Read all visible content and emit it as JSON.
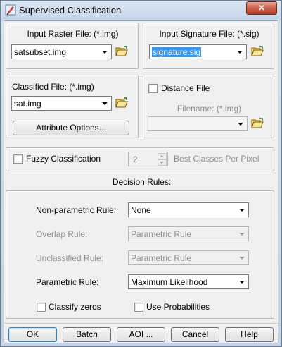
{
  "window": {
    "title": "Supervised Classification",
    "close_glyph": "✕",
    "icon": "app-pencil-icon"
  },
  "input_raster": {
    "label": "Input Raster File: (*.img)",
    "value": "satsubset.img",
    "folder_icon": "open-folder-icon"
  },
  "input_signature": {
    "label": "Input Signature File: (*.sig)",
    "value": "signature.sig",
    "folder_icon": "open-folder-icon"
  },
  "classified_file": {
    "label": "Classified File: (*.img)",
    "value": "sat.img",
    "attribute_button": "Attribute Options..."
  },
  "distance_file": {
    "checkbox_label": "Distance File",
    "filename_label": "Filename: (*.img)",
    "value": ""
  },
  "fuzzy": {
    "checkbox_label": "Fuzzy Classification",
    "best_classes_value": "2",
    "best_classes_label": "Best Classes Per Pixel"
  },
  "decision_rules": {
    "heading": "Decision Rules:",
    "non_parametric": {
      "label": "Non-parametric Rule:",
      "value": "None"
    },
    "overlap": {
      "label": "Overlap Rule:",
      "value": "Parametric Rule"
    },
    "unclassified": {
      "label": "Unclassified Rule:",
      "value": "Parametric Rule"
    },
    "parametric": {
      "label": "Parametric Rule:",
      "value": "Maximum Likelihood"
    },
    "classify_zeros": "Classify zeros",
    "use_probabilities": "Use Probabilities"
  },
  "buttons": {
    "ok": "OK",
    "batch": "Batch",
    "aoi": "AOI ...",
    "cancel": "Cancel",
    "help": "Help"
  },
  "colors": {
    "selection": "#3399ff",
    "close_button": "#c75a45",
    "dialog_bg": "#f0f0f0"
  }
}
